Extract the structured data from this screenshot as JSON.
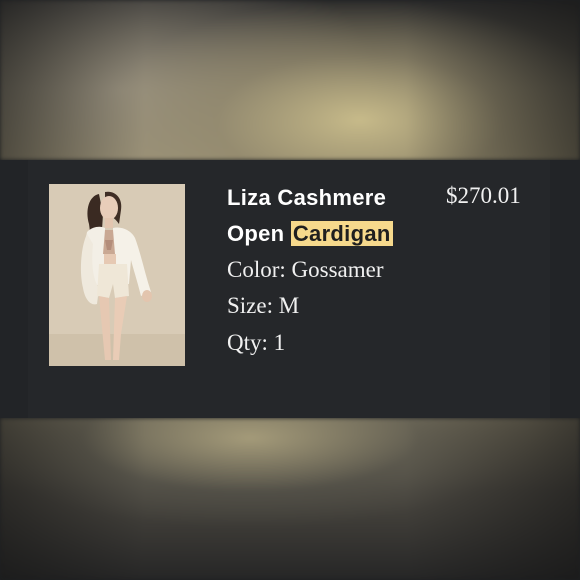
{
  "product": {
    "title_main": "Liza Cashmere Open ",
    "title_highlight": "Cardigan",
    "price": "$270.01",
    "color_label": "Color: Gossamer",
    "size_label": "Size: M",
    "qty_label": "Qty: 1"
  },
  "colors": {
    "card_background": "#25272a",
    "highlight": "#f6d98c",
    "text": "#ffffff"
  }
}
